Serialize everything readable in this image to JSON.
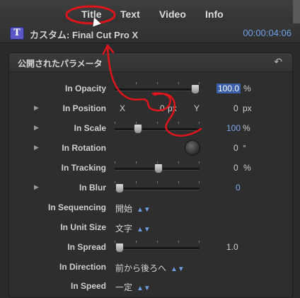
{
  "tabs": [
    {
      "label": "Title"
    },
    {
      "label": "Text"
    },
    {
      "label": "Video"
    },
    {
      "label": "Info"
    }
  ],
  "header": {
    "icon_letter": "T",
    "title": "カスタム: Final Cut Pro X",
    "timecode": "00:00:04:06"
  },
  "panel": {
    "title": "公開されたパラメータ",
    "reset_icon": "↶"
  },
  "params": {
    "in_opacity": {
      "label": "In Opacity",
      "value": "100.0",
      "unit": "%"
    },
    "in_position": {
      "label": "In Position",
      "x_label": "X",
      "x_value": "0",
      "x_unit": "px",
      "y_label": "Y",
      "y_value": "0",
      "y_unit": "px"
    },
    "in_scale": {
      "label": "In Scale",
      "value": "100",
      "unit": "%"
    },
    "in_rotation": {
      "label": "In Rotation",
      "value": "0",
      "unit": "°"
    },
    "in_tracking": {
      "label": "In Tracking",
      "value": "0",
      "unit": "%"
    },
    "in_blur": {
      "label": "In Blur",
      "value": "0"
    },
    "in_sequencing": {
      "label": "In Sequencing",
      "value": "開始"
    },
    "in_unit_size": {
      "label": "In Unit Size",
      "value": "文字"
    },
    "in_spread": {
      "label": "In Spread",
      "value": "1.0"
    },
    "in_direction": {
      "label": "In Direction",
      "value": "前から後ろへ"
    },
    "in_speed": {
      "label": "In Speed",
      "value": "一定"
    }
  },
  "colors": {
    "accent_blue": "#6ea0e6",
    "annotation_red": "#e0141b",
    "title_icon": "#5a58c7"
  }
}
